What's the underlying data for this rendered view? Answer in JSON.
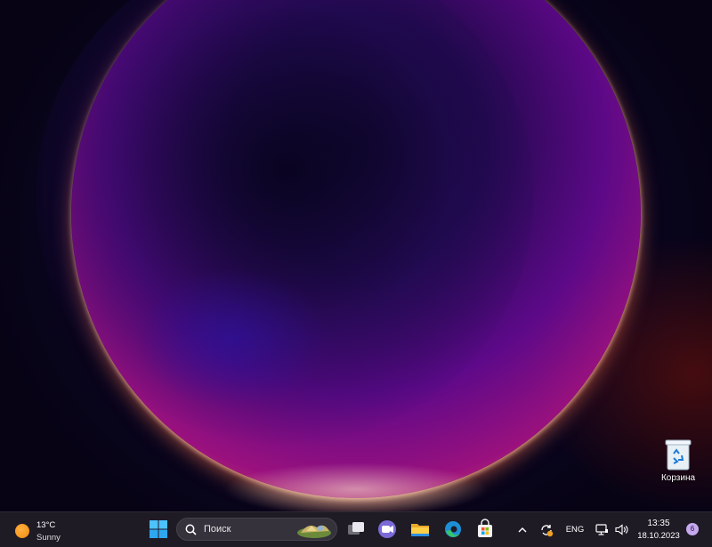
{
  "desktop": {
    "icons": [
      {
        "name": "recycle-bin",
        "label": "Корзина"
      }
    ]
  },
  "taskbar": {
    "weather": {
      "temperature": "13°C",
      "condition": "Sunny",
      "icon": "sun-icon"
    },
    "search": {
      "placeholder": "Поиск"
    },
    "apps": [
      {
        "name": "start-button",
        "icon": "windows-logo-icon"
      },
      {
        "name": "task-view-button",
        "icon": "task-view-icon"
      },
      {
        "name": "teams-chat-button",
        "icon": "teams-chat-icon"
      },
      {
        "name": "file-explorer-button",
        "icon": "folder-icon"
      },
      {
        "name": "edge-browser-button",
        "icon": "edge-icon"
      },
      {
        "name": "store-button",
        "icon": "store-bag-icon"
      }
    ],
    "tray": {
      "language": "ENG",
      "time": "13:35",
      "date": "18.10.2023",
      "notification_count": "6"
    }
  }
}
